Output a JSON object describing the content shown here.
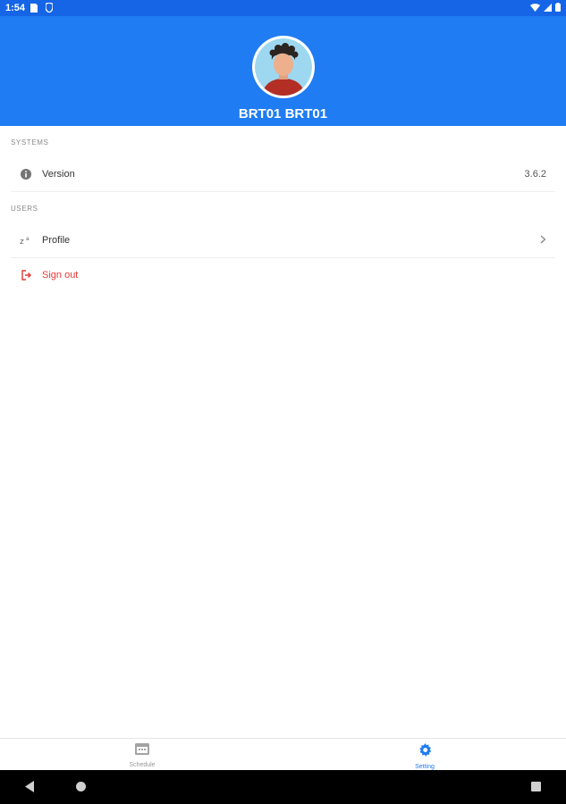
{
  "status_bar": {
    "time": "1:54"
  },
  "header": {
    "user_name": "BRT01 BRT01"
  },
  "sections": {
    "systems": {
      "title": "SYSTEMS",
      "version_label": "Version",
      "version_value": "3.6.2"
    },
    "users": {
      "title": "USERS",
      "profile_label": "Profile",
      "signout_label": "Sign out"
    }
  },
  "bottom_nav": {
    "tabs": [
      {
        "label": "Schedule",
        "icon": "calendar-icon",
        "active": false
      },
      {
        "label": "Setting",
        "icon": "gear-icon",
        "active": true
      }
    ]
  },
  "colors": {
    "primary": "#1f7cf2",
    "status_bar": "#1565e6",
    "danger": "#e53935"
  }
}
